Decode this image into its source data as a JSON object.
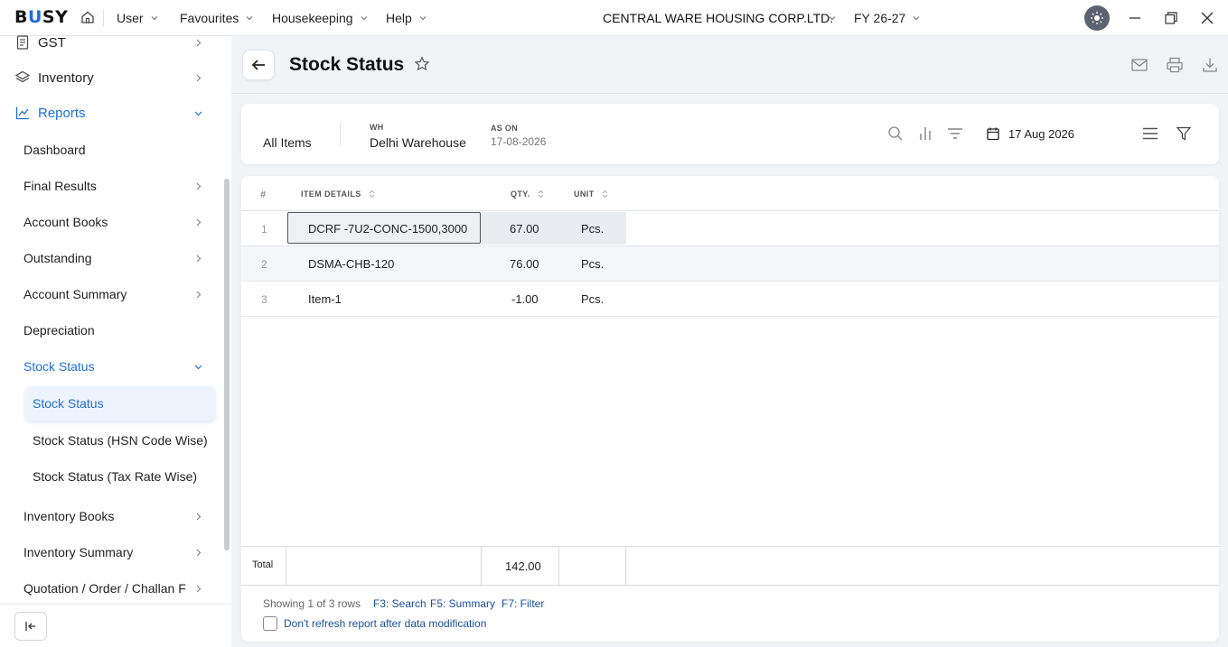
{
  "app": {
    "logo_prefix": "B",
    "logo_accent": "U",
    "logo_suffix": "SY"
  },
  "menu": [
    {
      "label": "User"
    },
    {
      "label": "Favourites"
    },
    {
      "label": "Housekeeping"
    },
    {
      "label": "Help"
    }
  ],
  "company": {
    "name": "CENTRAL WARE HOUSING CORP.LTD.",
    "fy": "FY 26-27"
  },
  "sidebar": {
    "top_items": [
      {
        "label": "GST",
        "icon": "document-icon"
      },
      {
        "label": "Inventory",
        "icon": "layers-icon"
      },
      {
        "label": "Reports",
        "icon": "chart-line-icon"
      }
    ],
    "report_items": [
      {
        "label": "Dashboard"
      },
      {
        "label": "Final Results"
      },
      {
        "label": "Account Books"
      },
      {
        "label": "Outstanding"
      },
      {
        "label": "Account Summary"
      },
      {
        "label": "Depreciation"
      },
      {
        "label": "Stock Status"
      },
      {
        "label": "Inventory Books"
      },
      {
        "label": "Inventory Summary"
      },
      {
        "label": "Quotation / Order / Challan F"
      }
    ],
    "stock_sub_items": [
      {
        "label": "Stock Status"
      },
      {
        "label": "Stock Status (HSN Code Wise)"
      },
      {
        "label": "Stock Status (Tax Rate Wise)"
      }
    ]
  },
  "page": {
    "title": "Stock Status"
  },
  "filters": {
    "items_label": "All Items",
    "wh_label": "WH",
    "wh_value": "Delhi Warehouse",
    "ason_label": "AS ON",
    "ason_value": "17-08-2026",
    "date": "17 Aug 2026"
  },
  "table": {
    "columns": [
      "#",
      "ITEM DETAILS",
      "QTY.",
      "UNIT"
    ],
    "rows": [
      {
        "no": "1",
        "item": "DCRF -7U2-CONC-1500,3000",
        "qty": "67.00",
        "unit": "Pcs."
      },
      {
        "no": "2",
        "item": "DSMA-CHB-120",
        "qty": "76.00",
        "unit": "Pcs."
      },
      {
        "no": "3",
        "item": "Item-1",
        "qty": "-1.00",
        "unit": "Pcs."
      }
    ],
    "total_label": "Total",
    "total_qty": "142.00"
  },
  "footer": {
    "showing": "Showing 1 of 3 rows",
    "shortcuts": [
      "F3: Search",
      "F5: Summary",
      "F7: Filter"
    ],
    "checkbox_label": "Don't refresh report after data modification"
  },
  "colors": {
    "accent": "#1e6fd9",
    "link": "#1a4f9c"
  }
}
